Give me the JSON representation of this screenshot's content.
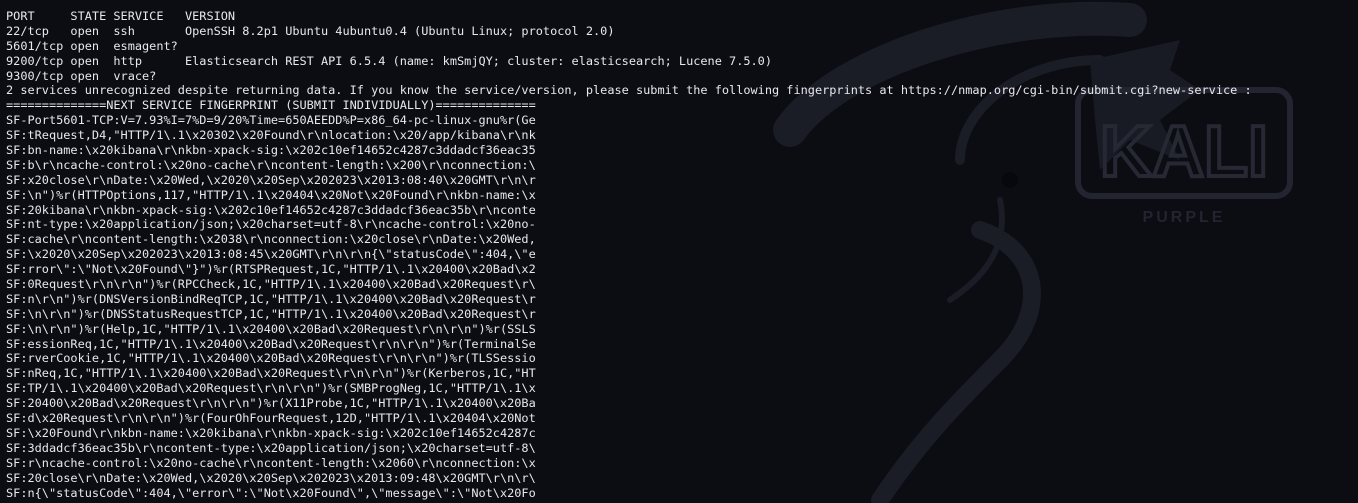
{
  "terminal": {
    "background_color": "#0b0d13",
    "text_color": "#e8e8ee",
    "wallpaper_logo_text": "KALI",
    "wallpaper_logo_subtext": "PURPLE",
    "lines": [
      "PORT     STATE SERVICE   VERSION",
      "22/tcp   open  ssh       OpenSSH 8.2p1 Ubuntu 4ubuntu0.4 (Ubuntu Linux; protocol 2.0)",
      "5601/tcp open  esmagent?",
      "9200/tcp open  http      Elasticsearch REST API 6.5.4 (name: kmSmjQY; cluster: elasticsearch; Lucene 7.5.0)",
      "9300/tcp open  vrace?",
      "2 services unrecognized despite returning data. If you know the service/version, please submit the following fingerprints at https://nmap.org/cgi-bin/submit.cgi?new-service :",
      "==============NEXT SERVICE FINGERPRINT (SUBMIT INDIVIDUALLY)==============",
      "SF-Port5601-TCP:V=7.93%I=7%D=9/20%Time=650AEEDD%P=x86_64-pc-linux-gnu%r(Ge",
      "SF:tRequest,D4,\"HTTP/1\\.1\\x20302\\x20Found\\r\\nlocation:\\x20/app/kibana\\r\\nk",
      "SF:bn-name:\\x20kibana\\r\\nkbn-xpack-sig:\\x202c10ef14652c4287c3ddadcf36eac35",
      "SF:b\\r\\ncache-control:\\x20no-cache\\r\\ncontent-length:\\x200\\r\\nconnection:\\",
      "SF:x20close\\r\\nDate:\\x20Wed,\\x2020\\x20Sep\\x202023\\x2013:08:40\\x20GMT\\r\\n\\r",
      "SF:\\n\")%r(HTTPOptions,117,\"HTTP/1\\.1\\x20404\\x20Not\\x20Found\\r\\nkbn-name:\\x",
      "SF:20kibana\\r\\nkbn-xpack-sig:\\x202c10ef14652c4287c3ddadcf36eac35b\\r\\nconte",
      "SF:nt-type:\\x20application/json;\\x20charset=utf-8\\r\\ncache-control:\\x20no-",
      "SF:cache\\r\\ncontent-length:\\x2038\\r\\nconnection:\\x20close\\r\\nDate:\\x20Wed,",
      "SF:\\x2020\\x20Sep\\x202023\\x2013:08:45\\x20GMT\\r\\n\\r\\n{\\\"statusCode\\\":404,\\\"e",
      "SF:rror\\\":\\\"Not\\x20Found\\\"}\")%r(RTSPRequest,1C,\"HTTP/1\\.1\\x20400\\x20Bad\\x2",
      "SF:0Request\\r\\n\\r\\n\")%r(RPCCheck,1C,\"HTTP/1\\.1\\x20400\\x20Bad\\x20Request\\r\\",
      "SF:n\\r\\n\")%r(DNSVersionBindReqTCP,1C,\"HTTP/1\\.1\\x20400\\x20Bad\\x20Request\\r",
      "SF:\\n\\r\\n\")%r(DNSStatusRequestTCP,1C,\"HTTP/1\\.1\\x20400\\x20Bad\\x20Request\\r",
      "SF:\\n\\r\\n\")%r(Help,1C,\"HTTP/1\\.1\\x20400\\x20Bad\\x20Request\\r\\n\\r\\n\")%r(SSLS",
      "SF:essionReq,1C,\"HTTP/1\\.1\\x20400\\x20Bad\\x20Request\\r\\n\\r\\n\")%r(TerminalSe",
      "SF:rverCookie,1C,\"HTTP/1\\.1\\x20400\\x20Bad\\x20Request\\r\\n\\r\\n\")%r(TLSSessio",
      "SF:nReq,1C,\"HTTP/1\\.1\\x20400\\x20Bad\\x20Request\\r\\n\\r\\n\")%r(Kerberos,1C,\"HT",
      "SF:TP/1\\.1\\x20400\\x20Bad\\x20Request\\r\\n\\r\\n\")%r(SMBProgNeg,1C,\"HTTP/1\\.1\\x",
      "SF:20400\\x20Bad\\x20Request\\r\\n\\r\\n\")%r(X11Probe,1C,\"HTTP/1\\.1\\x20400\\x20Ba",
      "SF:d\\x20Request\\r\\n\\r\\n\")%r(FourOhFourRequest,12D,\"HTTP/1\\.1\\x20404\\x20Not",
      "SF:\\x20Found\\r\\nkbn-name:\\x20kibana\\r\\nkbn-xpack-sig:\\x202c10ef14652c4287c",
      "SF:3ddadcf36eac35b\\r\\ncontent-type:\\x20application/json;\\x20charset=utf-8\\",
      "SF:r\\ncache-control:\\x20no-cache\\r\\ncontent-length:\\x2060\\r\\nconnection:\\x",
      "SF:20close\\r\\nDate:\\x20Wed,\\x2020\\x20Sep\\x202023\\x2013:09:48\\x20GMT\\r\\n\\r\\",
      "SF:n{\\\"statusCode\\\":404,\\\"error\\\":\\\"Not\\x20Found\\\",\\\"message\\\":\\\"Not\\x20Fo"
    ]
  }
}
